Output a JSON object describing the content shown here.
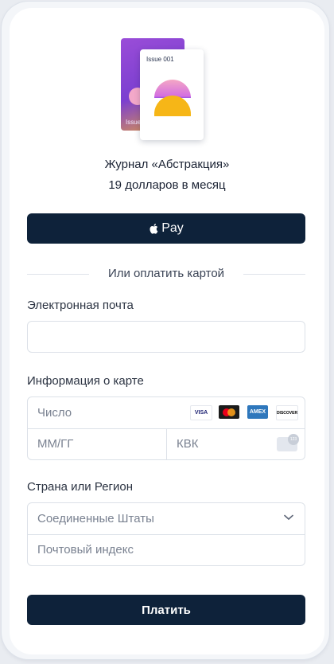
{
  "product": {
    "art_back_label": "Issue",
    "art_front_label": "Issue 001",
    "name": "Журнал «Абстракция»",
    "price": "19 долларов в месяц"
  },
  "apple_pay": {
    "label": "Pay"
  },
  "divider_text": "Или оплатить картой",
  "email": {
    "label": "Электронная почта",
    "value": "",
    "placeholder": ""
  },
  "card": {
    "label": "Информация о карте",
    "number_placeholder": "Число",
    "expiry_placeholder": "ММ/ГГ",
    "cvc_placeholder": "КВК",
    "cvc_badge": "123",
    "brands": [
      {
        "name": "VISA",
        "color": "#1a1f71",
        "bg": "#ffffff"
      },
      {
        "name": "mastercard",
        "color": "#eb001b",
        "bg": "#1b1b1b"
      },
      {
        "name": "AMEX",
        "color": "#ffffff",
        "bg": "#2e77bc"
      },
      {
        "name": "DISCOVER",
        "color": "#000000",
        "bg": "#ffffff"
      }
    ]
  },
  "region": {
    "label": "Страна или Регион",
    "country_value": "Соединенные Штаты",
    "zip_placeholder": "Почтовый индекс"
  },
  "submit": {
    "label": "Платить"
  },
  "colors": {
    "primary": "#0e223a",
    "border": "#dce1e8",
    "text": "#1a2233",
    "muted": "#7a8291"
  }
}
